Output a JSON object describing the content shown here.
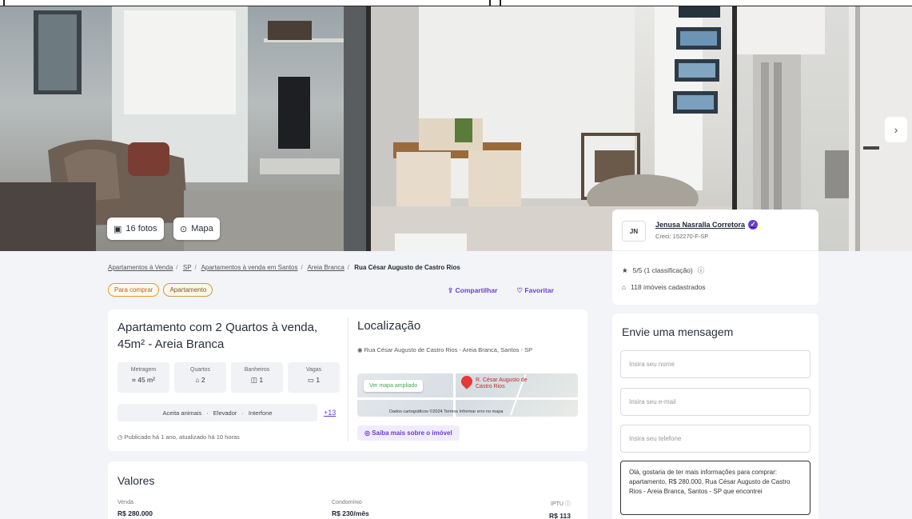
{
  "gallery": {
    "photos_btn": "16 fotos",
    "map_btn": "Mapa",
    "next_arrow": "›"
  },
  "breadcrumbs": {
    "items": [
      "Apartamentos à Venda",
      "SP",
      "Apartamentos à venda em Santos",
      "Areia Branca"
    ],
    "current": "Rua César Augusto de Castro Rios"
  },
  "tags": [
    "Para comprar",
    "Apartamento"
  ],
  "actions": {
    "share": "Compartilhar",
    "favorite": "Favoritar"
  },
  "listing": {
    "title": "Apartamento com 2 Quartos à venda, 45m² - Areia Branca",
    "features": [
      {
        "label": "Metragem",
        "value": "45 m²",
        "icon": "area-icon"
      },
      {
        "label": "Quartos",
        "value": "2",
        "icon": "bed-icon"
      },
      {
        "label": "Banheiros",
        "value": "1",
        "icon": "bath-icon"
      },
      {
        "label": "Vagas",
        "value": "1",
        "icon": "car-icon"
      }
    ],
    "amenities": [
      "Aceita animais",
      "Elevador",
      "Interfone"
    ],
    "amenities_more": "+13",
    "published": "Publicado há 1 ano, atualizado há 10 horas"
  },
  "location": {
    "title": "Localização",
    "address": "Rua César Augusto de Castro Rios - Areia Branca, Santos - SP",
    "map_button": "Ver mapa ampliado",
    "map_pin_label": "R. César Augusto de Castro Rios",
    "map_footer": "Dados cartográficos ©2024   Termos   Informar erro no mapa",
    "more_button": "Saiba mais sobre o imóvel"
  },
  "valores": {
    "title": "Valores",
    "items": [
      {
        "label": "Venda",
        "value": "R$ 280.000"
      },
      {
        "label": "Condomínio",
        "value": "R$ 230/mês"
      },
      {
        "label": "IPTU",
        "value": "R$ 113"
      }
    ]
  },
  "agent": {
    "initials": "JN",
    "name": "Jenusa Nasralla Corretora",
    "creci": "Creci: 152270-F-SP",
    "rating": "5/5 (1 classificação)",
    "listings": "118 imóveis cadastrados"
  },
  "message_form": {
    "title": "Envie uma mensagem",
    "name_placeholder": "Insira seu nome",
    "email_placeholder": "Insira seu e-mail",
    "phone_placeholder": "Insira seu telefone",
    "message": "Olá, gostaria de ter mais informações para comprar: apartamento, R$ 280.000, Rua César Augusto de Castro Rios - Areia Branca, Santos - SP que encontrei"
  },
  "colors": {
    "accent": "#6a3fd1",
    "tag_orange": "#e79a2b",
    "map_pin": "#e53935"
  }
}
